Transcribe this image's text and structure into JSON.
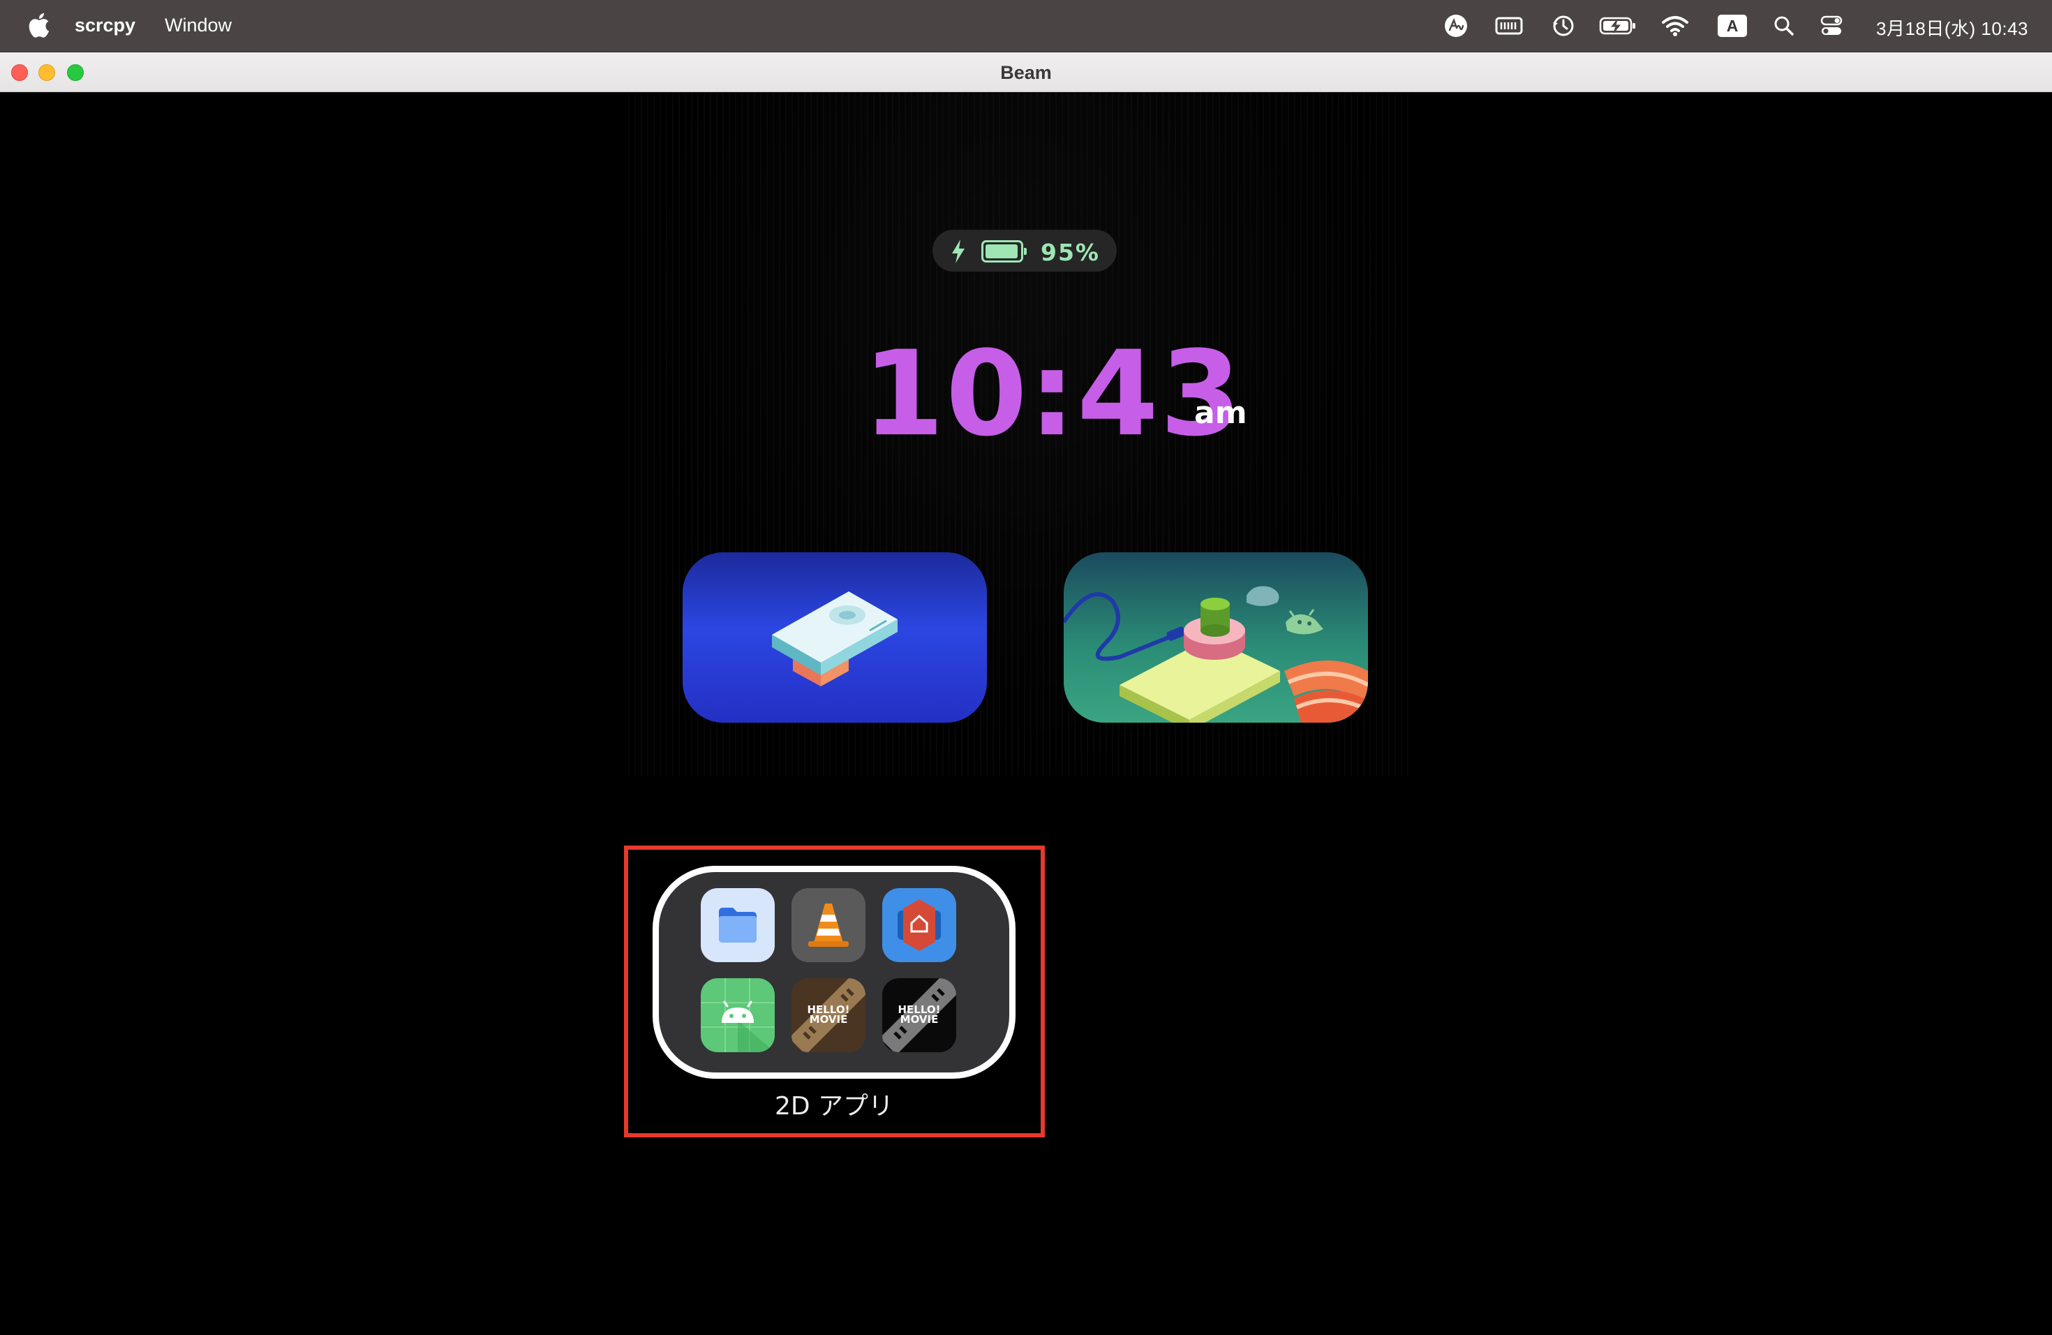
{
  "menubar": {
    "app_name": "scrcpy",
    "menu_window": "Window",
    "datetime": "3月18日(水) 10:43",
    "input_mode": "A",
    "tray_icons": [
      "handwriting-icon",
      "keyboard-icon",
      "time-machine-icon",
      "battery-charging-icon",
      "wifi-icon",
      "input-source-icon",
      "spotlight-search-icon",
      "control-center-icon"
    ]
  },
  "window": {
    "title": "Beam"
  },
  "lockscreen": {
    "battery_percent": "95%",
    "battery_level": 0.95,
    "battery_color": "#9ee6b4",
    "time": "10:43",
    "ampm": "am",
    "clock_color": "#c65ee8"
  },
  "widgets": [
    {
      "name": "projector-widget",
      "icon": "projector-illustration"
    },
    {
      "name": "android-xr-widget",
      "icon": "android-scene-illustration"
    }
  ],
  "folder": {
    "label": "2D アプリ",
    "highlight_color": "#e53a2c",
    "apps": [
      {
        "name": "files-app",
        "icon": "folder-icon"
      },
      {
        "name": "vlc-app",
        "icon": "traffic-cone-icon"
      },
      {
        "name": "home-app",
        "icon": "home-hex-icon"
      },
      {
        "name": "android-app",
        "icon": "android-robot-icon"
      },
      {
        "name": "hello-movie-app-1",
        "icon": "hello-movie-icon",
        "text": "HELLO! MOVIE"
      },
      {
        "name": "hello-movie-app-2",
        "icon": "hello-movie-icon",
        "text": "HELLO! MOVIE"
      }
    ]
  }
}
